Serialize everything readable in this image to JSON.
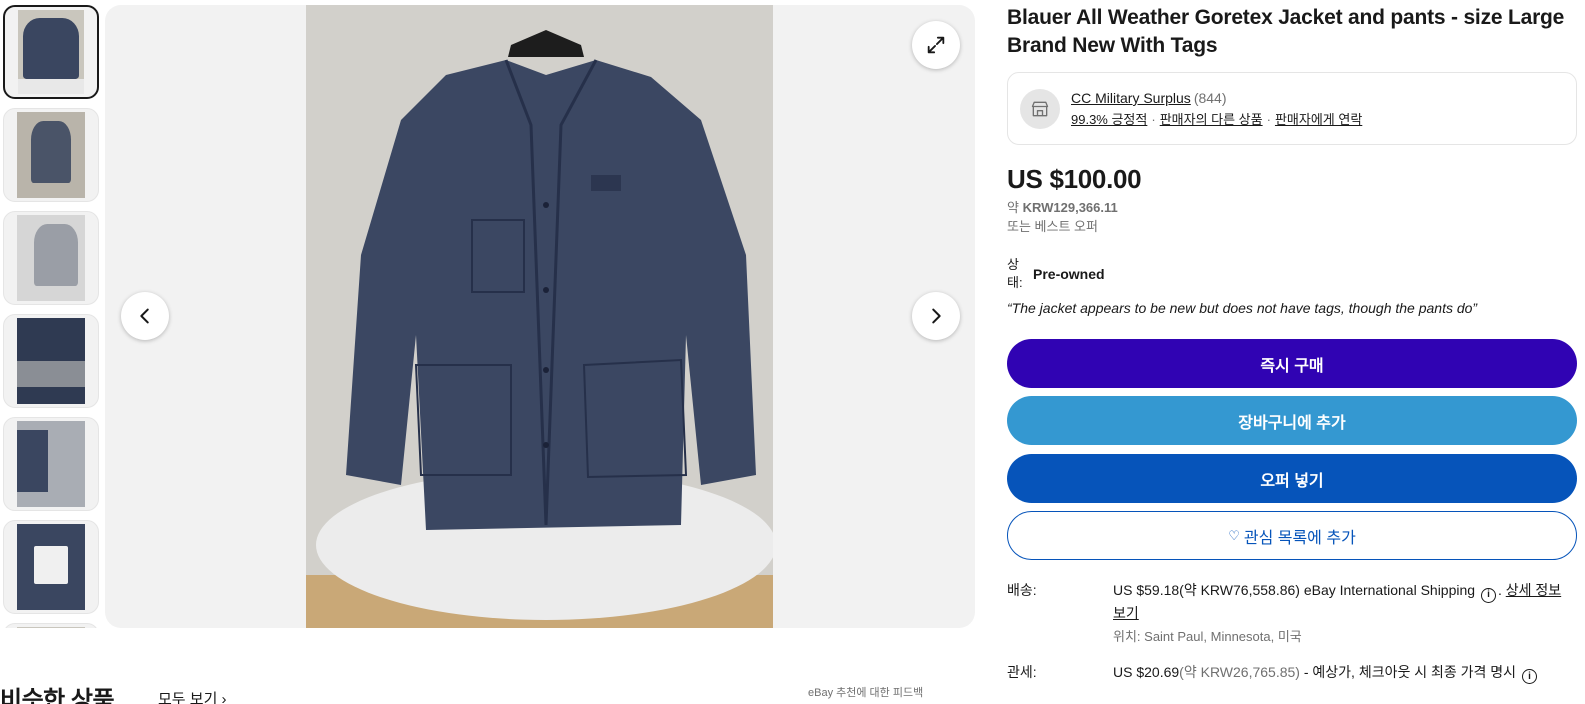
{
  "gallery": {
    "thumbnail_count": 7,
    "active_index": 0
  },
  "listing": {
    "title": "Blauer All Weather Goretex Jacket and pants - size Large Brand New With Tags"
  },
  "seller": {
    "name": "CC Military Surplus",
    "feedback_count": "(844)",
    "positive": "99.3% 긍정적",
    "other_items": "판매자의 다른 상품",
    "contact": "판매자에게 연락",
    "separator": "·"
  },
  "price": {
    "amount": "US $100.00",
    "approx_prefix": "약 ",
    "approx_value": "KRW129,366.11",
    "best_offer": "또는 베스트 오퍼"
  },
  "condition": {
    "label": "상태:",
    "value": "Pre-owned",
    "quote": "“The jacket appears to be new but does not have tags, though the pants do”"
  },
  "actions": {
    "buy_now": "즉시 구매",
    "add_to_cart": "장바구니에 추가",
    "make_offer": "오퍼 넣기",
    "watchlist": "관심 목록에 추가",
    "heart_glyph": "♡"
  },
  "shipping": {
    "label": "배송:",
    "value": "US $59.18(약 KRW76,558.86) eBay International Shipping",
    "dot": ".",
    "details_link": "상세 정보 보기",
    "location": "위치: Saint Paul, Minnesota, 미국"
  },
  "duties": {
    "label": "관세:",
    "value_main": "US $20.69",
    "value_approx": "(약 KRW26,765.85)",
    "value_note": " - 예상가, 체크아웃 시 최종 가격 명시"
  },
  "below": {
    "similar_title": "비슷한 상품",
    "see_all": "모두 보기 ›",
    "feedback": "eBay 추천에 대한 피드백"
  },
  "colors": {
    "buy": "#3003b3",
    "cart": "#3498d1",
    "offer": "#0654ba"
  }
}
